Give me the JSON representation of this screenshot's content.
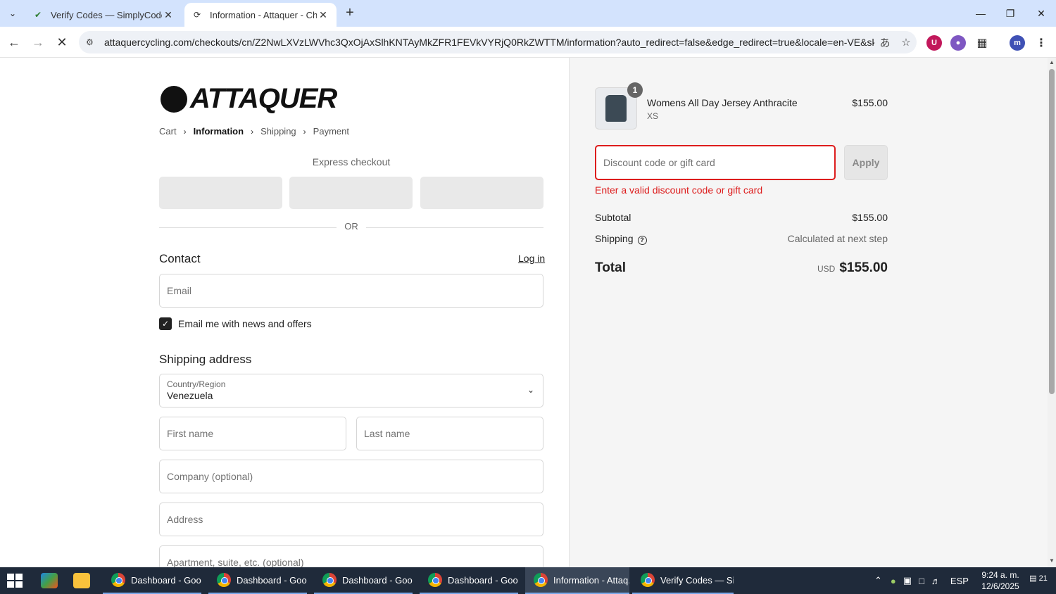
{
  "browser": {
    "tabs": [
      {
        "title": "Verify Codes — SimplyCodes",
        "favicon": "simplycodes-icon"
      },
      {
        "title": "Information - Attaquer - Checkout",
        "favicon": "loading-icon"
      }
    ],
    "url": "attaquercycling.com/checkouts/cn/Z2NwLXVzLWVhc3QxOjAxSlhKNTAyMkZFR1FEVkVYRjQ0RkZWTTM/information?auto_redirect=false&edge_redirect=true&locale=en-VE&skip_shop_..."
  },
  "checkout": {
    "logo_text": "ATTAQUER",
    "breadcrumb": [
      "Cart",
      "Information",
      "Shipping",
      "Payment"
    ],
    "express_label": "Express checkout",
    "or_label": "OR",
    "contact_title": "Contact",
    "login_label": "Log in",
    "email_placeholder": "Email",
    "newsletter_label": "Email me with news and offers",
    "newsletter_checked": true,
    "shipping_title": "Shipping address",
    "country_label": "Country/Region",
    "country_value": "Venezuela",
    "first_name_placeholder": "First name",
    "last_name_placeholder": "Last name",
    "company_placeholder": "Company (optional)",
    "address_placeholder": "Address",
    "apartment_placeholder": "Apartment, suite, etc. (optional)"
  },
  "summary": {
    "item": {
      "quantity": "1",
      "name": "Womens All Day Jersey Anthracite",
      "variant": "XS",
      "price": "$155.00"
    },
    "discount_placeholder": "Discount code or gift card",
    "apply_label": "Apply",
    "discount_error": "Enter a valid discount code or gift card",
    "subtotal_label": "Subtotal",
    "subtotal_value": "$155.00",
    "shipping_label": "Shipping",
    "shipping_value": "Calculated at next step",
    "total_label": "Total",
    "total_currency": "USD",
    "total_value": "$155.00"
  },
  "taskbar": {
    "apps": [
      "Dashboard - Googl...",
      "Dashboard - Googl...",
      "Dashboard - Googl...",
      "Dashboard - Googl...",
      "Information - Attaq...",
      "Verify Codes — Sim..."
    ],
    "language": "ESP",
    "time": "9:24 a. m.",
    "date": "12/6/2025",
    "notifications": "21"
  }
}
